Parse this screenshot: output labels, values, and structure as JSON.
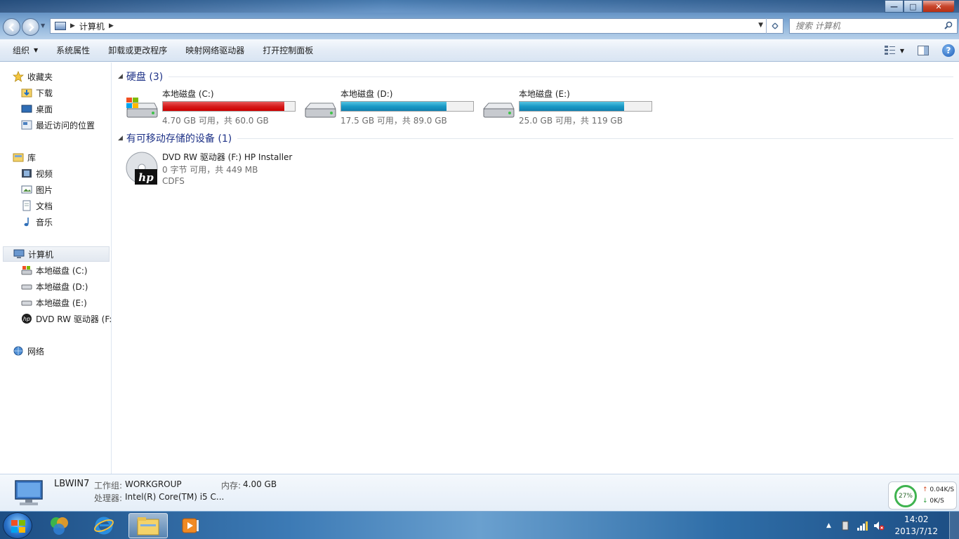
{
  "window": {
    "address": {
      "crumbs": [
        "计算机"
      ]
    },
    "search": {
      "placeholder": "搜索 计算机"
    },
    "controls": {
      "minimize": "—",
      "maximize": "□",
      "close": "✕"
    }
  },
  "commandbar": {
    "organize": "组织",
    "system_properties": "系统属性",
    "uninstall": "卸载或更改程序",
    "map_drive": "映射网络驱动器",
    "control_panel": "打开控制面板",
    "help": "?"
  },
  "sidebar": {
    "favorites": {
      "label": "收藏夹",
      "items": [
        {
          "label": "下载",
          "icon": "download-folder-icon"
        },
        {
          "label": "桌面",
          "icon": "desktop-icon"
        },
        {
          "label": "最近访问的位置",
          "icon": "recent-places-icon"
        }
      ]
    },
    "libraries": {
      "label": "库",
      "items": [
        {
          "label": "视频",
          "icon": "video-icon"
        },
        {
          "label": "图片",
          "icon": "pictures-icon"
        },
        {
          "label": "文档",
          "icon": "documents-icon"
        },
        {
          "label": "音乐",
          "icon": "music-icon"
        }
      ]
    },
    "computer": {
      "label": "计算机",
      "items": [
        {
          "label": "本地磁盘 (C:)",
          "icon": "system-drive-icon"
        },
        {
          "label": "本地磁盘 (D:)",
          "icon": "drive-icon"
        },
        {
          "label": "本地磁盘 (E:)",
          "icon": "drive-icon"
        },
        {
          "label": "DVD RW 驱动器 (F:",
          "icon": "hp-dvd-icon"
        }
      ]
    },
    "network": {
      "label": "网络"
    }
  },
  "content": {
    "hard_disks": {
      "header": "硬盘 (3)",
      "drives": [
        {
          "name": "本地磁盘 (C:)",
          "free_text": "4.70 GB 可用，共 60.0 GB",
          "used_fraction": 0.92,
          "status": "red"
        },
        {
          "name": "本地磁盘 (D:)",
          "free_text": "17.5 GB 可用，共 89.0 GB",
          "used_fraction": 0.8,
          "status": "blue"
        },
        {
          "name": "本地磁盘 (E:)",
          "free_text": "25.0 GB 可用，共 119 GB",
          "used_fraction": 0.79,
          "status": "blue"
        }
      ]
    },
    "removable": {
      "header": "有可移动存储的设备 (1)",
      "device": {
        "name": "DVD RW 驱动器 (F:) HP Installer",
        "free_text": "0 字节 可用，共 449 MB",
        "filesystem": "CDFS"
      }
    }
  },
  "details": {
    "computer_name": "LBWIN7",
    "workgroup_label": "工作组:",
    "workgroup": "WORKGROUP",
    "memory_label": "内存:",
    "memory": "4.00 GB",
    "processor_label": "处理器:",
    "processor": "Intel(R) Core(TM) i5 C..."
  },
  "netmon": {
    "percent": "27%",
    "up": "0.04K/S",
    "down": "0K/S"
  },
  "taskbar": {
    "time": "14:02",
    "date": "2013/7/12"
  },
  "colors": {
    "drive_red": "#d61c1c",
    "drive_blue": "#1a9ac6",
    "group_header": "#1e3287"
  }
}
